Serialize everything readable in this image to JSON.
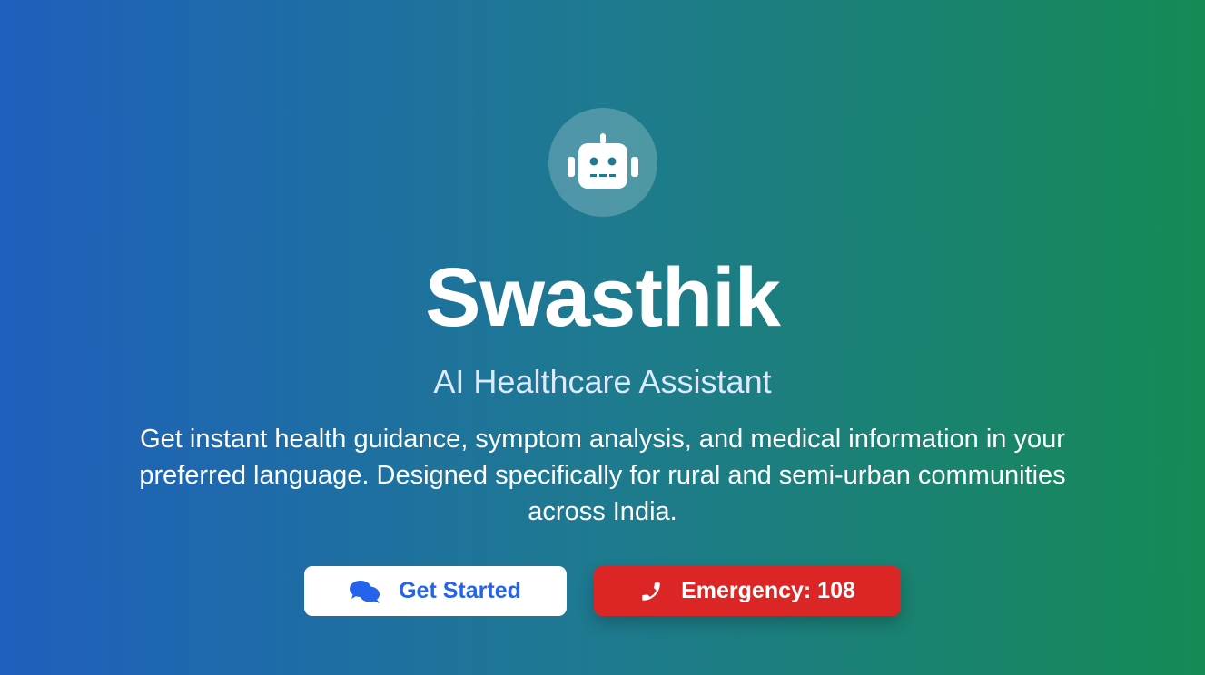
{
  "hero": {
    "logo_icon": "robot-icon",
    "title": "Swasthik",
    "subtitle": "AI Healthcare Assistant",
    "description": "Get instant health guidance, symptom analysis, and medical information in your preferred language. Designed specifically for rural and semi-urban communities across India."
  },
  "actions": {
    "get_started": {
      "label": "Get Started",
      "icon": "chat-bubbles-icon"
    },
    "emergency": {
      "label": "Emergency: 108",
      "icon": "phone-icon"
    }
  },
  "colors": {
    "gradient_start": "#1f5fbd",
    "gradient_end": "#168a55",
    "primary_blue": "#2563eb",
    "emergency_red": "#dc2626"
  }
}
